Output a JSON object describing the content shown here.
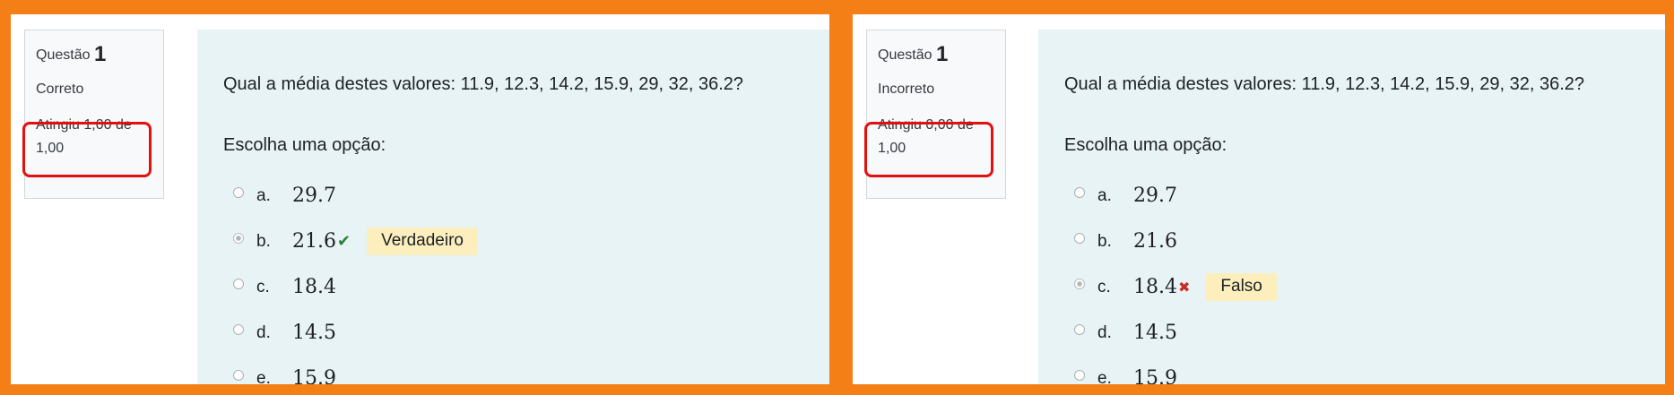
{
  "colors": {
    "frame": "#f57f17",
    "content_bg": "#e7f3f5",
    "highlight": "#e31010",
    "correct": "#2b7f3b",
    "incorrect": "#c92a2a",
    "feedback_bg": "#fcefbd"
  },
  "left": {
    "info": {
      "question_label": "Questão",
      "question_number": "1",
      "state": "Correto",
      "grade_line1": "Atingiu 1,00 de",
      "grade_line2": "1,00"
    },
    "question_text": "Qual a média destes valores: 11.9, 12.3, 14.2, 15.9, 29, 32, 36.2?",
    "prompt": "Escolha uma opção:",
    "options": [
      {
        "letter": "a.",
        "value": "29.7"
      },
      {
        "letter": "b.",
        "value": "21.6",
        "selected": true,
        "mark_icon": "check-icon",
        "feedback": "Verdadeiro"
      },
      {
        "letter": "c.",
        "value": "18.4"
      },
      {
        "letter": "d.",
        "value": "14.5"
      },
      {
        "letter": "e.",
        "value": "15.9"
      }
    ]
  },
  "right": {
    "info": {
      "question_label": "Questão",
      "question_number": "1",
      "state": "Incorreto",
      "grade_line1": "Atingiu 0,00 de",
      "grade_line2": "1,00"
    },
    "question_text": "Qual a média destes valores: 11.9, 12.3, 14.2, 15.9, 29, 32, 36.2?",
    "prompt": "Escolha uma opção:",
    "options": [
      {
        "letter": "a.",
        "value": "29.7"
      },
      {
        "letter": "b.",
        "value": "21.6"
      },
      {
        "letter": "c.",
        "value": "18.4",
        "selected": true,
        "mark_icon": "cross-icon",
        "feedback": "Falso"
      },
      {
        "letter": "d.",
        "value": "14.5"
      },
      {
        "letter": "e.",
        "value": "15.9"
      }
    ]
  }
}
